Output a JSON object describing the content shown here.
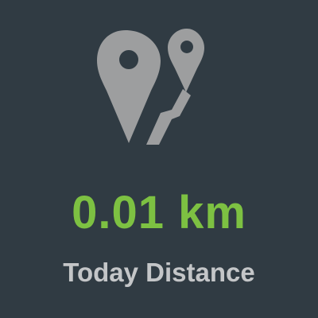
{
  "widget": {
    "icon": "route-pins-icon",
    "distance_value": "0.01 km",
    "label": "Today Distance"
  },
  "colors": {
    "background": "#303b43",
    "icon": "#9d9e9f",
    "distance": "#7dc142",
    "label": "#c4c6c8"
  }
}
